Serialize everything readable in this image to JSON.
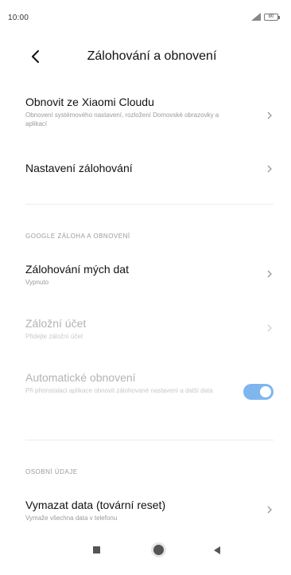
{
  "status_bar": {
    "time": "10:00",
    "battery_text": "80"
  },
  "header": {
    "title": "Zálohování a obnovení"
  },
  "items": {
    "restore_cloud": {
      "title": "Obnovit ze Xiaomi Cloudu",
      "subtitle": "Obnovení systémového nastavení, rozložení Domovské obrazovky a aplikací"
    },
    "backup_settings": {
      "title": "Nastavení zálohování"
    },
    "backup_my_data": {
      "title": "Zálohování mých dat",
      "subtitle": "Vypnuto"
    },
    "backup_account": {
      "title": "Záložní účet",
      "subtitle": "Přidejte záložní účet"
    },
    "auto_restore": {
      "title": "Automatické obnovení",
      "subtitle": "Při přeinstalaci aplikace obnovit zálohované nastavení a další data",
      "toggle_on": true
    },
    "factory_reset": {
      "title": "Vymazat data (tovární reset)",
      "subtitle": "Vymaže všechna data v telefonu"
    }
  },
  "sections": {
    "google": "GOOGLE ZÁLOHA A OBNOVENÍ",
    "personal": "OSOBNÍ ÚDAJE"
  },
  "colors": {
    "toggle_on": "#7fb6ee",
    "divider": "#ececec"
  },
  "icons": {
    "back": "back-arrow-icon",
    "chevron": "chevron-right-icon",
    "signal": "signal-icon",
    "battery": "battery-icon"
  }
}
